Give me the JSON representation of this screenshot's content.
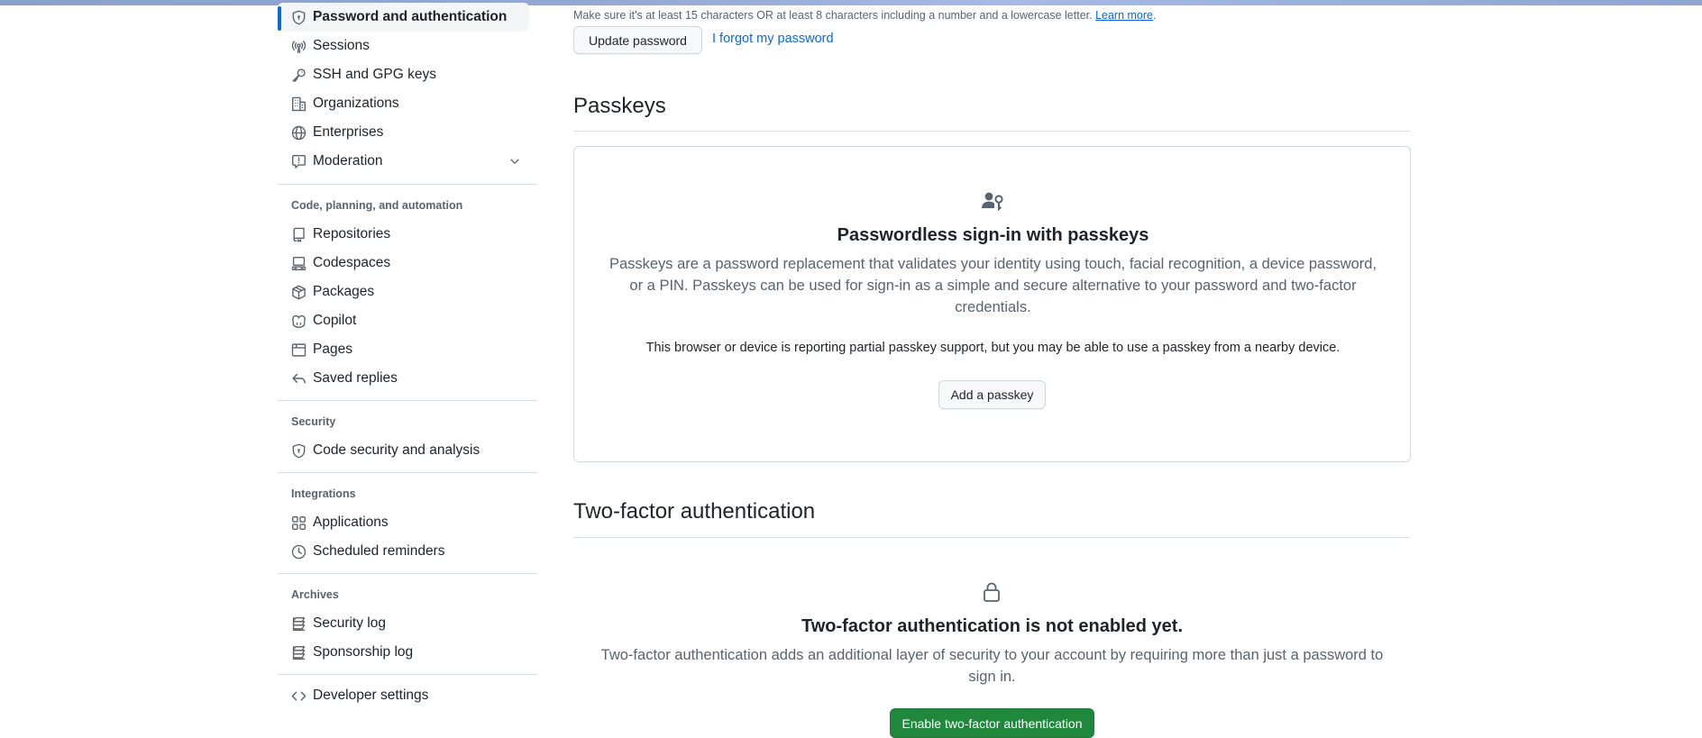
{
  "sidebar": {
    "items_top": [
      {
        "label": "Password and authentication",
        "icon": "shield-lock-icon",
        "active": true
      },
      {
        "label": "Sessions",
        "icon": "broadcast-icon"
      },
      {
        "label": "SSH and GPG keys",
        "icon": "key-icon"
      },
      {
        "label": "Organizations",
        "icon": "organization-icon"
      },
      {
        "label": "Enterprises",
        "icon": "globe-icon"
      },
      {
        "label": "Moderation",
        "icon": "report-icon"
      }
    ],
    "section_code": {
      "heading": "Code, planning, and automation",
      "items": [
        {
          "label": "Repositories",
          "icon": "repo-icon"
        },
        {
          "label": "Codespaces",
          "icon": "codespaces-icon"
        },
        {
          "label": "Packages",
          "icon": "package-icon"
        },
        {
          "label": "Copilot",
          "icon": "copilot-icon"
        },
        {
          "label": "Pages",
          "icon": "browser-icon"
        },
        {
          "label": "Saved replies",
          "icon": "reply-icon"
        }
      ]
    },
    "section_security": {
      "heading": "Security",
      "items": [
        {
          "label": "Code security and analysis",
          "icon": "shield-lock-icon"
        }
      ]
    },
    "section_integrations": {
      "heading": "Integrations",
      "items": [
        {
          "label": "Applications",
          "icon": "apps-icon"
        },
        {
          "label": "Scheduled reminders",
          "icon": "clock-icon"
        }
      ]
    },
    "section_archives": {
      "heading": "Archives",
      "items": [
        {
          "label": "Security log",
          "icon": "log-icon"
        },
        {
          "label": "Sponsorship log",
          "icon": "log-icon"
        }
      ]
    },
    "developer_settings": {
      "label": "Developer settings",
      "icon": "code-icon"
    }
  },
  "password": {
    "hint": "Make sure it's at least 15 characters OR at least 8 characters including a number and a lowercase letter.",
    "learn_more": "Learn more",
    "update_button": "Update password",
    "forgot_link": "I forgot my password"
  },
  "passkeys": {
    "heading": "Passkeys",
    "icon": "passkey-icon",
    "title": "Passwordless sign-in with passkeys",
    "description_line1": "Passkeys are a password replacement that validates your identity using touch, facial recognition, a device password,",
    "description_line2": "or a PIN. Passkeys can be used for sign-in as a simple and secure alternative to your password and two-factor",
    "description_line3": "credentials.",
    "support_note": "This browser or device is reporting partial passkey support, but you may be able to use a passkey from a nearby device.",
    "add_button": "Add a passkey"
  },
  "two_factor": {
    "heading": "Two-factor authentication",
    "icon": "lock-icon",
    "title": "Two-factor authentication is not enabled yet.",
    "description_line1": "Two-factor authentication adds an additional layer of security to your account by requiring more than just a password to",
    "description_line2": "sign in.",
    "enable_button": "Enable two-factor authentication"
  },
  "colors": {
    "accent": "#0969da",
    "primary_button": "#1f883d",
    "muted_text": "#59636e",
    "border": "#d0d7de"
  }
}
